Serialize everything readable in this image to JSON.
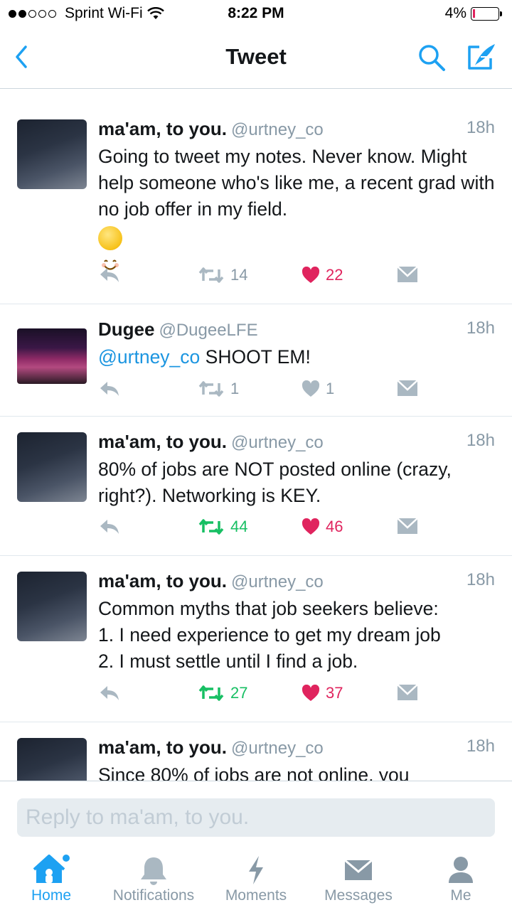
{
  "status_bar": {
    "carrier": "Sprint Wi-Fi",
    "time": "8:22 PM",
    "battery": "4%"
  },
  "nav": {
    "title": "Tweet"
  },
  "tweets": [
    {
      "name": "ma'am, to you.",
      "handle": "@urtney_co",
      "time": "18h",
      "text": "Going to tweet my notes. Never know. Might help someone who's like me, a recent grad with no job offer in my field.",
      "emoji": "smiling-face",
      "retweets": "14",
      "likes": "22",
      "retweeted": false,
      "liked": true
    },
    {
      "name": "Dugee",
      "handle": "@DugeeLFE",
      "time": "18h",
      "mention": "@urtney_co",
      "text": " SHOOT EM!",
      "retweets": "1",
      "likes": "1",
      "retweeted": false,
      "liked": false
    },
    {
      "name": "ma'am, to you.",
      "handle": "@urtney_co",
      "time": "18h",
      "text": "80% of jobs are NOT posted online (crazy, right?). Networking is KEY.",
      "retweets": "44",
      "likes": "46",
      "retweeted": true,
      "liked": true
    },
    {
      "name": "ma'am, to you.",
      "handle": "@urtney_co",
      "time": "18h",
      "text": "Common myths that job seekers believe:\n1.  I need experience to get my dream job\n2. I must settle until I find a job.",
      "retweets": "27",
      "likes": "37",
      "retweeted": true,
      "liked": true
    },
    {
      "name": "ma'am, to you.",
      "handle": "@urtney_co",
      "time": "18h",
      "text": "Since 80% of jobs are not online, you"
    }
  ],
  "reply": {
    "placeholder": "Reply to ma'am, to you."
  },
  "tabs": [
    {
      "label": "Home",
      "icon": "home-icon",
      "active": true
    },
    {
      "label": "Notifications",
      "icon": "bell-icon"
    },
    {
      "label": "Moments",
      "icon": "lightning-icon"
    },
    {
      "label": "Messages",
      "icon": "envelope-icon"
    },
    {
      "label": "Me",
      "icon": "person-icon"
    }
  ],
  "colors": {
    "accent": "#1da1f2",
    "like": "#e0245e",
    "retweet": "#17bf63",
    "muted": "#8899a6"
  }
}
